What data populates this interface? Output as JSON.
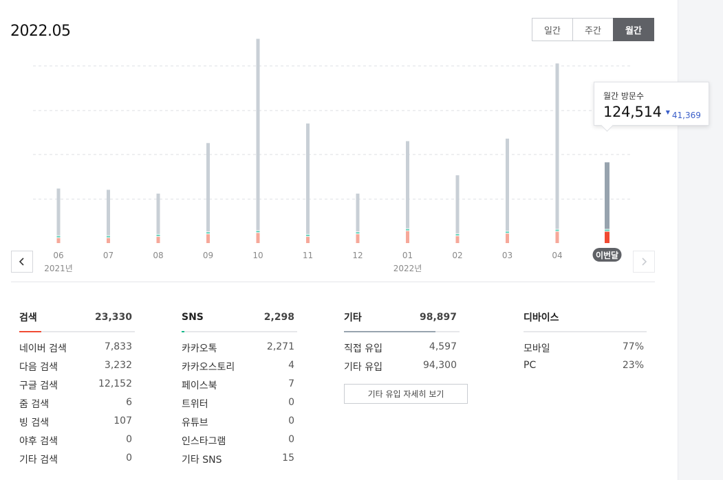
{
  "title": "2022.05",
  "period_tabs": [
    {
      "label": "일간",
      "active": false
    },
    {
      "label": "주간",
      "active": false
    },
    {
      "label": "월간",
      "active": true
    }
  ],
  "chart_data": {
    "type": "bar",
    "categories": [
      "06",
      "07",
      "08",
      "09",
      "10",
      "11",
      "12",
      "01",
      "02",
      "03",
      "04",
      "이번달"
    ],
    "year_labels": [
      {
        "label": "2021년",
        "index": 0
      },
      {
        "label": "2022년",
        "index": 7
      }
    ],
    "series": [
      {
        "name": "검색",
        "values": [
          8000,
          8000,
          10000,
          14000,
          16000,
          10000,
          14000,
          19000,
          11000,
          15000,
          18000,
          18000
        ]
      },
      {
        "name": "SNS",
        "values": [
          1000,
          1000,
          1000,
          1000,
          1000,
          1000,
          1000,
          1000,
          1000,
          1000,
          1000,
          1000
        ]
      },
      {
        "name": "기타",
        "values": [
          74000,
          72000,
          64000,
          140000,
          303000,
          175000,
          60000,
          138000,
          92000,
          146000,
          262000,
          105514
        ]
      }
    ],
    "ylim": [
      0,
      350000
    ],
    "grid": true,
    "highlight_index": 11,
    "colors": {
      "search": "#f6a89a",
      "search_current": "#f04a32",
      "sns": "#5fd0b8",
      "other": "#c8cfd6",
      "other_current": "#97a3ae",
      "grid": "#dcdfe3",
      "badge_bg": "#5f6166"
    }
  },
  "tooltip": {
    "label": "월간 방문수",
    "value": "124,514",
    "delta": "41,369",
    "delta_direction": "down"
  },
  "nav": {
    "prev_icon": "chevron-left-icon",
    "next_icon": "chevron-right-icon"
  },
  "stats": {
    "search": {
      "label": "검색",
      "total": "23,330",
      "accent": "#f04a32",
      "share": 0.19,
      "rows": [
        {
          "label": "네이버 검색",
          "value": "7,833"
        },
        {
          "label": "다음 검색",
          "value": "3,232"
        },
        {
          "label": "구글 검색",
          "value": "12,152"
        },
        {
          "label": "줌 검색",
          "value": "6"
        },
        {
          "label": "빙 검색",
          "value": "107"
        },
        {
          "label": "야후 검색",
          "value": "0"
        },
        {
          "label": "기타 검색",
          "value": "0"
        }
      ]
    },
    "sns": {
      "label": "SNS",
      "total": "2,298",
      "accent": "#15b98a",
      "share": 0.02,
      "rows": [
        {
          "label": "카카오톡",
          "value": "2,271"
        },
        {
          "label": "카카오스토리",
          "value": "4"
        },
        {
          "label": "페이스북",
          "value": "7"
        },
        {
          "label": "트위터",
          "value": "0"
        },
        {
          "label": "유튜브",
          "value": "0"
        },
        {
          "label": "인스타그램",
          "value": "0"
        },
        {
          "label": "기타 SNS",
          "value": "15"
        }
      ]
    },
    "other": {
      "label": "기타",
      "total": "98,897",
      "accent": "#97a3ae",
      "share": 0.79,
      "rows": [
        {
          "label": "직접 유입",
          "value": "4,597"
        },
        {
          "label": "기타 유입",
          "value": "94,300"
        }
      ],
      "detail_button": "기타 유입 자세히 보기"
    },
    "device": {
      "label": "디바이스",
      "rows": [
        {
          "label": "모바일",
          "value": "77%"
        },
        {
          "label": "PC",
          "value": "23%"
        }
      ]
    }
  }
}
